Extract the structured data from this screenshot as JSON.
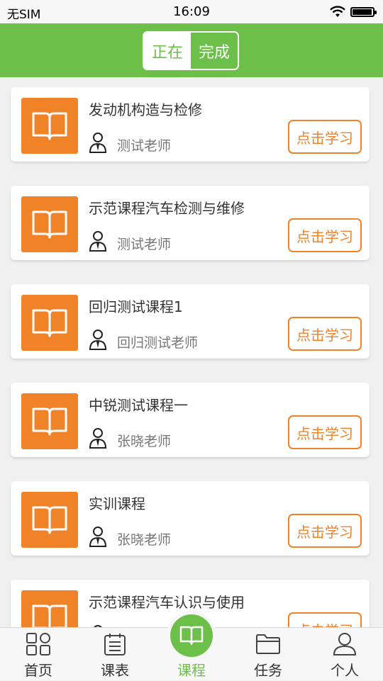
{
  "status_bar": {
    "carrier": "无SIM",
    "time": "16:09",
    "battery_level": 0.95
  },
  "header": {
    "segments": [
      {
        "label": "正在",
        "active": false
      },
      {
        "label": "完成",
        "active": true
      }
    ]
  },
  "courses": [
    {
      "title": "发动机构造与检修",
      "teacher": "测试老师",
      "button": "点击学习"
    },
    {
      "title": "示范课程汽车检测与维修",
      "teacher": "测试老师",
      "button": "点击学习"
    },
    {
      "title": "回归测试课程1",
      "teacher": "回归测试老师",
      "button": "点击学习"
    },
    {
      "title": "中锐测试课程一",
      "teacher": "张晓老师",
      "button": "点击学习"
    },
    {
      "title": "实训课程",
      "teacher": "张晓老师",
      "button": "点击学习"
    },
    {
      "title": "示范课程汽车认识与使用",
      "teacher": "",
      "button": "点击学习"
    }
  ],
  "tabbar": {
    "tabs": [
      {
        "label": "首页",
        "icon": "grid-icon"
      },
      {
        "label": "课表",
        "icon": "schedule-icon"
      },
      {
        "label": "课程",
        "icon": "book-icon",
        "active": true
      },
      {
        "label": "任务",
        "icon": "folder-icon"
      },
      {
        "label": "个人",
        "icon": "person-icon"
      }
    ]
  },
  "colors": {
    "primary_green": "#6cc04a",
    "accent_orange": "#f08228"
  }
}
